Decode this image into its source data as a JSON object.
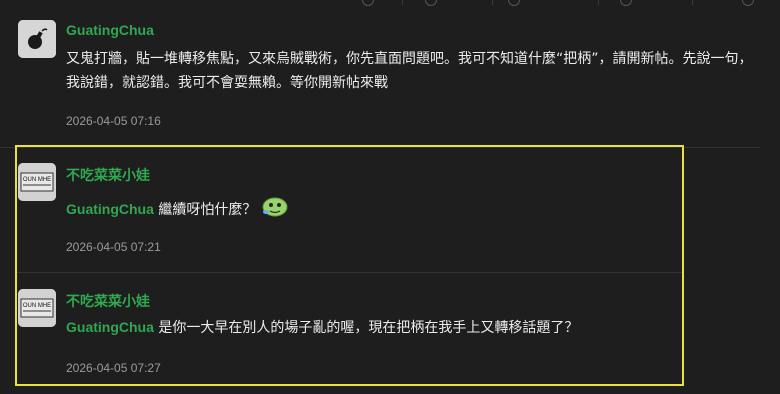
{
  "posts": [
    {
      "author": "GuatingChua",
      "text": "又鬼打牆，貼一堆轉移焦點，又來烏賊戰術，你先直面問題吧。我可不知道什麼“把柄”，請開新帖。先說一句，我說錯，就認錯。我可不會耍無賴。等你開新帖來戰",
      "time": "2026-04-05 07:16"
    },
    {
      "author": "不吃菜菜小娃",
      "mention": "GuatingChua",
      "text": " 繼續呀怕什麼？",
      "time": "2026-04-05 07:21"
    },
    {
      "author": "不吃菜菜小娃",
      "mention": "GuatingChua",
      "text": " 是你一大早在別人的場子亂的喔，現在把柄在我手上又轉移話題了？",
      "time": "2026-04-05 07:27"
    }
  ],
  "avatar_logo_text": "OUN MHE",
  "icons": [
    "bomb-avatar-icon",
    "emoji-sticker-icon"
  ],
  "colors": {
    "accent": "#2fa84f",
    "highlight": "#e8e23a",
    "background": "#1e1e1e"
  }
}
